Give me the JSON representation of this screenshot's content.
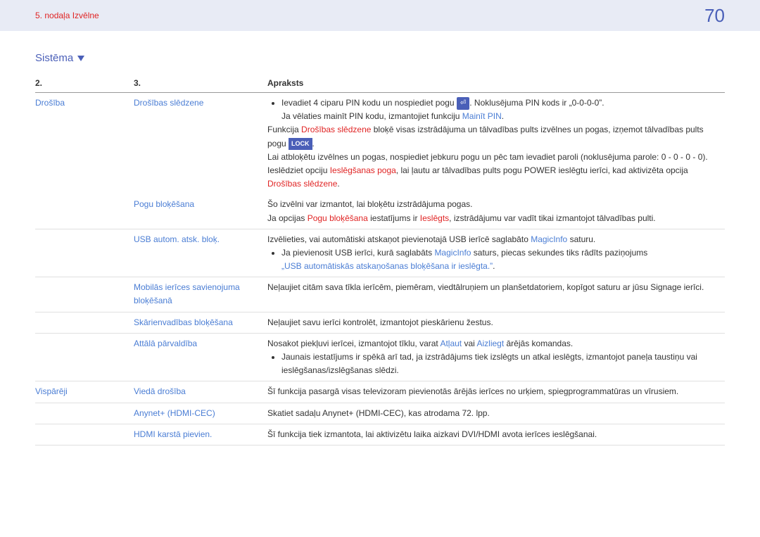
{
  "header": {
    "chapter": "5. nodaļa Izvēlne",
    "page": "70"
  },
  "section_title": "Sistēma",
  "table": {
    "col2": "2.",
    "col3": "3.",
    "col_desc": "Apraksts"
  },
  "rows": {
    "drosiba": "Drošība",
    "drosibas_sledzene": "Drošības slēdzene",
    "ds_bullet": "Ievadiet 4 ciparu PIN kodu un nospiediet pogu ",
    "ds_bullet_after": ". Noklusējuma PIN kods ir „0-0-0-0”.",
    "ds_line2_a": "Ja vēlaties mainīt PIN kodu, izmantojiet funkciju ",
    "ds_line2_b": "Mainīt PIN",
    "ds_line2_c": ".",
    "ds_line3_a": "Funkcija ",
    "ds_line3_b": "Drošības slēdzene",
    "ds_line3_c": " bloķē visas izstrādājuma un tālvadības pults izvēlnes un pogas, izņemot tālvadības pults pogu ",
    "ds_lock": "LOCK",
    "ds_line3_d": ".",
    "ds_line4": "Lai atbloķētu izvēlnes un pogas, nospiediet jebkuru pogu un pēc tam ievadiet paroli (noklusējuma parole: 0 - 0 - 0 - 0).",
    "ds_line5_a": "Ieslēdziet opciju ",
    "ds_line5_b": "Ieslēgšanas poga",
    "ds_line5_c": ", lai ļautu ar tālvadības pults pogu POWER ieslēgtu ierīci, kad aktivizēta opcija ",
    "ds_line5_d": "Drošības slēdzene",
    "ds_line5_e": ".",
    "pogu": "Pogu bloķēšana",
    "pogu_line1": "Šo izvēlni var izmantot, lai bloķētu izstrādājuma pogas.",
    "pogu_line2_a": "Ja opcijas ",
    "pogu_line2_b": "Pogu bloķēšana",
    "pogu_line2_c": " iestatījums ir ",
    "pogu_line2_d": "Ieslēgts",
    "pogu_line2_e": ", izstrādājumu var vadīt tikai izmantojot tālvadības pulti.",
    "usb": "USB autom. atsk. bloķ.",
    "usb_line1_a": "Izvēlieties, vai automātiski atskaņot pievienotajā USB ierīcē saglabāto ",
    "usb_line1_b": "MagicInfo",
    "usb_line1_c": " saturu.",
    "usb_bullet_a": "Ja pievienosit USB ierīci, kurā saglabāts ",
    "usb_bullet_b": "MagicInfo",
    "usb_bullet_c": " saturs, piecas sekundes tiks rādīts paziņojums ",
    "usb_bullet_d": "„USB automātiskās atskaņošanas bloķēšana ir ieslēgta.”",
    "usb_bullet_e": ".",
    "mobile": "Mobilās ierīces savienojuma bloķēšanā",
    "mobile_desc": "Neļaujiet citām sava tīkla ierīcēm, piemēram, viedtālruņiem un planšetdatoriem, kopīgot saturu ar jūsu Signage ierīci.",
    "skarien": "Skārienvadības bloķēšana",
    "skarien_desc": "Neļaujiet savu ierīci kontrolēt, izmantojot pieskārienu žestus.",
    "attala": "Attālā pārvaldība",
    "attala_line1_a": "Nosakot piekļuvi ierīcei, izmantojot tīklu, varat ",
    "attala_line1_b": "Atļaut",
    "attala_line1_c": " vai ",
    "attala_line1_d": "Aizliegt",
    "attala_line1_e": " ārējās komandas.",
    "attala_bullet": "Jaunais iestatījums ir spēkā arī tad, ja izstrādājums tiek izslēgts un atkal ieslēgts, izmantojot paneļa taustiņu vai ieslēgšanas/izslēgšanas slēdzi.",
    "vispareji": "Vispārēji",
    "vieda": "Viedā drošība",
    "vieda_desc": "Šī funkcija pasargā visas televizoram pievienotās ārējās ierīces no urķiem, spiegprogrammatūras un vīrusiem.",
    "anynet": "Anynet+ (HDMI-CEC)",
    "anynet_desc": "Skatiet sadaļu Anynet+ (HDMI-CEC), kas atrodama 72. lpp.",
    "hdmi": "HDMI karstā pievien.",
    "hdmi_desc": "Šī funkcija tiek izmantota, lai aktivizētu laika aizkavi DVI/HDMI avota ierīces ieslēgšanai."
  }
}
